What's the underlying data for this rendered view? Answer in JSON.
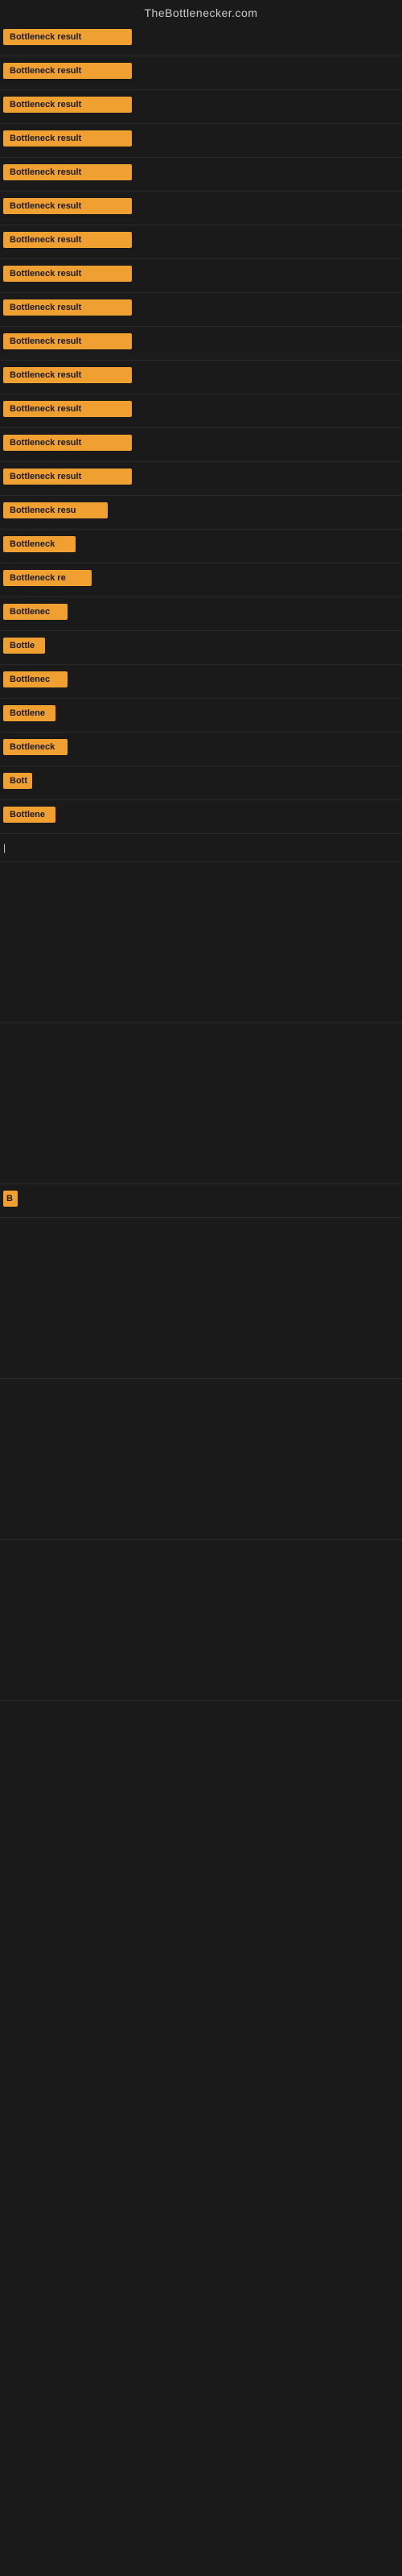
{
  "site": {
    "title": "TheBottlenecker.com"
  },
  "rows": [
    {
      "id": 1,
      "label": "Bottleneck result",
      "width": "full"
    },
    {
      "id": 2,
      "label": "Bottleneck result",
      "width": "full"
    },
    {
      "id": 3,
      "label": "Bottleneck result",
      "width": "full"
    },
    {
      "id": 4,
      "label": "Bottleneck result",
      "width": "full"
    },
    {
      "id": 5,
      "label": "Bottleneck result",
      "width": "full"
    },
    {
      "id": 6,
      "label": "Bottleneck result",
      "width": "full"
    },
    {
      "id": 7,
      "label": "Bottleneck result",
      "width": "full"
    },
    {
      "id": 8,
      "label": "Bottleneck result",
      "width": "full"
    },
    {
      "id": 9,
      "label": "Bottleneck result",
      "width": "full"
    },
    {
      "id": 10,
      "label": "Bottleneck result",
      "width": "full"
    },
    {
      "id": 11,
      "label": "Bottleneck result",
      "width": "full"
    },
    {
      "id": 12,
      "label": "Bottleneck result",
      "width": "full"
    },
    {
      "id": 13,
      "label": "Bottleneck result",
      "width": "full"
    },
    {
      "id": 14,
      "label": "Bottleneck result",
      "width": "full"
    },
    {
      "id": 15,
      "label": "Bottleneck resu",
      "width": "cut1"
    },
    {
      "id": 16,
      "label": "Bottleneck",
      "width": "cut2"
    },
    {
      "id": 17,
      "label": "Bottleneck re",
      "width": "cut3"
    },
    {
      "id": 18,
      "label": "Bottlenec",
      "width": "cut2"
    },
    {
      "id": 19,
      "label": "Bottle",
      "width": "cut4"
    },
    {
      "id": 20,
      "label": "Bottlenec",
      "width": "cut2"
    },
    {
      "id": 21,
      "label": "Bottlene",
      "width": "cut5"
    },
    {
      "id": 22,
      "label": "Bottleneck",
      "width": "cut2"
    },
    {
      "id": 23,
      "label": "Bott",
      "width": "cut6"
    },
    {
      "id": 24,
      "label": "Bottlene",
      "width": "cut5"
    },
    {
      "id": 25,
      "label": "|",
      "width": "tiny"
    },
    {
      "id": 26,
      "label": "B",
      "width": "tiny2"
    }
  ],
  "colors": {
    "badge_bg": "#f0a030",
    "badge_text": "#1a1a1a",
    "page_bg": "#1a1a1a",
    "title_color": "#cccccc"
  }
}
